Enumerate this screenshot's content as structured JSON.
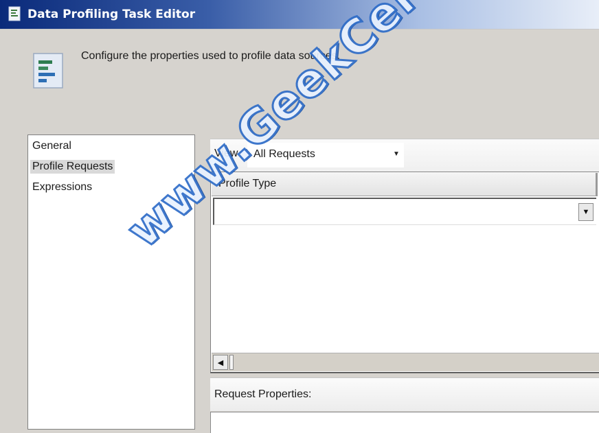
{
  "window": {
    "title": "Data Profiling Task Editor",
    "icon": "document-icon"
  },
  "header": {
    "description": "Configure the properties used to profile data sources.",
    "icon": "data-profiling-icon"
  },
  "nav": {
    "items": [
      {
        "label": "General",
        "selected": false
      },
      {
        "label": "Profile Requests",
        "selected": true
      },
      {
        "label": "Expressions",
        "selected": false
      }
    ]
  },
  "view": {
    "label": "View",
    "selected_value": "All Requests"
  },
  "grid": {
    "columns": [
      "Profile Type"
    ],
    "rows": [
      {
        "profile_type": ""
      }
    ]
  },
  "request_properties": {
    "label": "Request Properties:"
  },
  "watermark": "www.GeekCert.com",
  "colors": {
    "titlebar_start": "#0a2a7a",
    "window_bg": "#d6d3ce",
    "watermark": "#2e6cc8"
  }
}
